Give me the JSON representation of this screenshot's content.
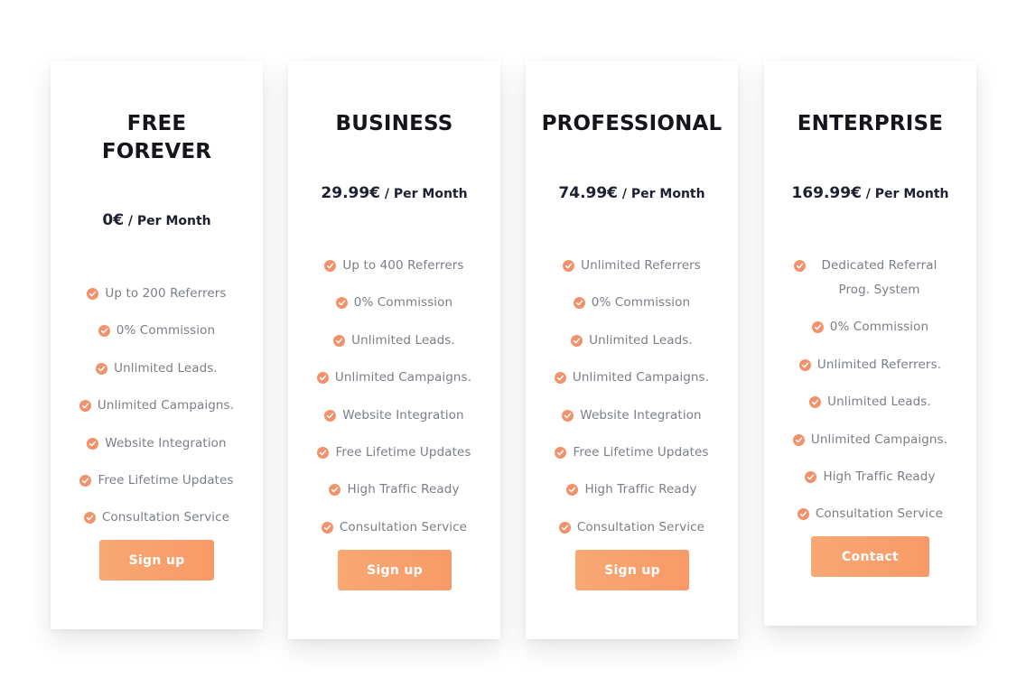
{
  "colors": {
    "accent": "#f89f6c",
    "check": "#f2916a",
    "title": "#14161c",
    "feature_text": "#7a7f86"
  },
  "plans": [
    {
      "title": "FREE FOREVER",
      "price": "0€",
      "price_suffix": " / Per Month",
      "features": [
        "Up to 200 Referrers",
        "0% Commission",
        "Unlimited Leads.",
        "Unlimited Campaigns.",
        "Website Integration",
        "Free Lifetime Updates",
        "Consultation Service"
      ],
      "cta": "Sign up"
    },
    {
      "title": "BUSINESS",
      "price": "29.99€",
      "price_suffix": " / Per Month",
      "features": [
        "Up to 400 Referrers",
        "0% Commission",
        "Unlimited Leads.",
        "Unlimited Campaigns.",
        "Website Integration",
        "Free Lifetime Updates",
        "High Traffic Ready",
        "Consultation Service"
      ],
      "cta": "Sign up"
    },
    {
      "title": "PROFESSIONAL",
      "price": "74.99€",
      "price_suffix": " / Per Month",
      "features": [
        "Unlimited Referrers",
        "0% Commission",
        "Unlimited Leads.",
        "Unlimited Campaigns.",
        "Website Integration",
        "Free Lifetime Updates",
        "High Traffic Ready",
        "Consultation Service"
      ],
      "cta": "Sign up"
    },
    {
      "title": "ENTERPRISE",
      "price": "169.99€",
      "price_suffix": " / Per Month",
      "features": [
        "Dedicated Referral Prog. System",
        "0% Commission",
        "Unlimited Referrers.",
        "Unlimited Leads.",
        "Unlimited Campaigns.",
        "High Traffic Ready",
        "Consultation Service"
      ],
      "cta": "Contact"
    }
  ]
}
